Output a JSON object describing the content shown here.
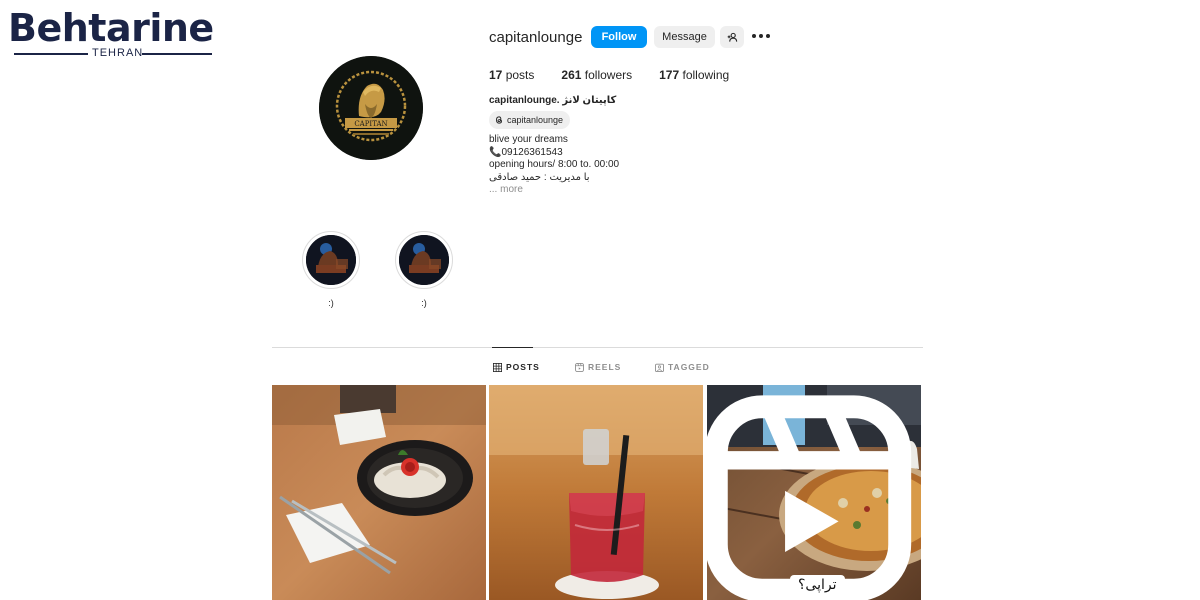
{
  "watermark": {
    "brand": "Behtarine",
    "city": "TEHRAN"
  },
  "profile": {
    "username": "capitanlounge",
    "follow_label": "Follow",
    "message_label": "Message",
    "stats": {
      "posts_count": "17",
      "posts_label": "posts",
      "followers_count": "261",
      "followers_label": "followers",
      "following_count": "177",
      "following_label": "following"
    },
    "display_name": "capitanlounge. کاپیتان لانژ",
    "threads_handle": "capitanlounge",
    "bio": {
      "line1": "blive your dreams",
      "phone": "📞09126361543",
      "hours": "opening hours/ 8:00 to. 00:00",
      "manager": "با مدیریت : حمید صادقی",
      "more": "... more"
    },
    "avatar_lettering": "CAPITAN"
  },
  "highlights": [
    {
      "label": ":)"
    },
    {
      "label": ":)"
    }
  ],
  "tabs": [
    {
      "label": "POSTS",
      "active": true,
      "icon": "grid-icon"
    },
    {
      "label": "REELS",
      "active": false,
      "icon": "reels-icon"
    },
    {
      "label": "TAGGED",
      "active": false,
      "icon": "tagged-icon"
    }
  ],
  "posts": [
    {
      "subject": "pasta-dish",
      "is_reel": false
    },
    {
      "subject": "red-drink",
      "is_reel": false
    },
    {
      "subject": "pizza",
      "is_reel": true,
      "caption": "تراپی؟"
    }
  ],
  "colors": {
    "follow_button": "#0095f6",
    "secondary_button": "#efefef",
    "text": "#262626",
    "muted": "#8e8e8e",
    "brand_navy": "#1b2446",
    "brand_red": "#c8102e"
  }
}
